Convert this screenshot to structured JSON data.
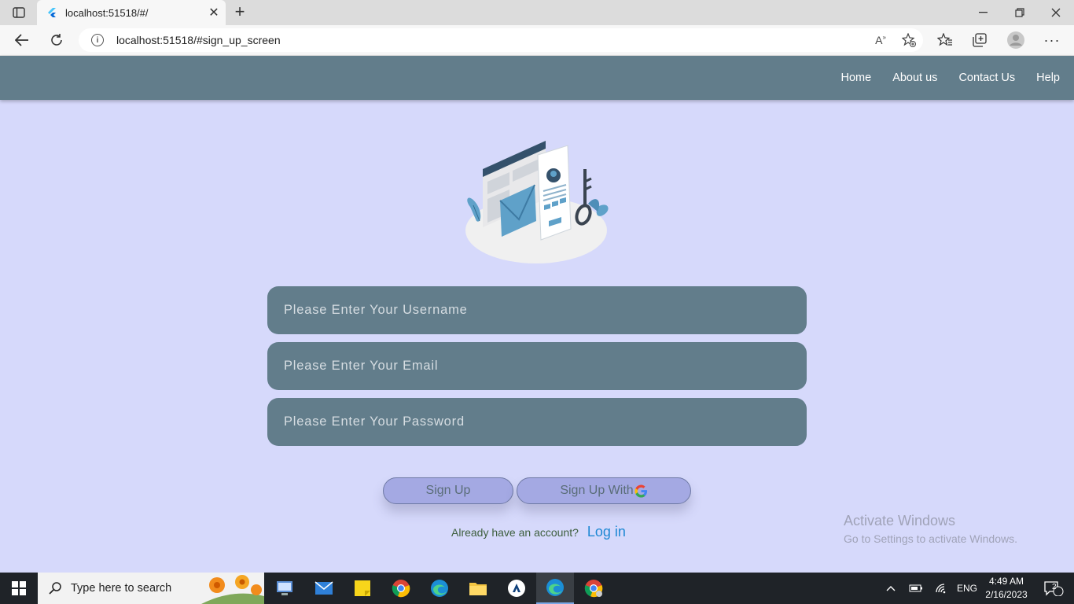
{
  "browser": {
    "tab_title": "localhost:51518/#/",
    "url": "localhost:51518/#sign_up_screen"
  },
  "appbar": {
    "nav": [
      "Home",
      "About us",
      "Contact Us",
      "Help"
    ]
  },
  "form": {
    "username_placeholder": "Please Enter Your Username",
    "email_placeholder": "Please Enter Your Email",
    "password_placeholder": "Please Enter Your Password",
    "signup_label": "Sign Up",
    "signup_google_label": "Sign Up With",
    "login_prompt": "Already have an account?",
    "login_link": "Log in"
  },
  "watermark": {
    "line1": "Activate Windows",
    "line2": "Go to Settings to activate Windows."
  },
  "taskbar": {
    "search_placeholder": "Type here to search",
    "lang": "ENG",
    "time": "4:49 AM",
    "date": "2/16/2023",
    "notifications": "2"
  }
}
